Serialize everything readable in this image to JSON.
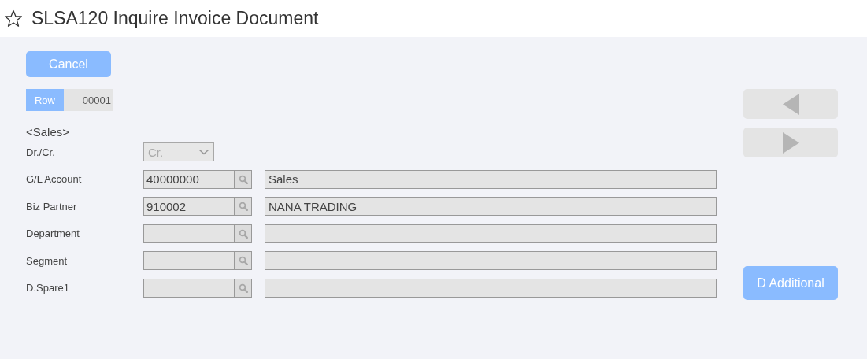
{
  "title": "SLSA120 Inquire Invoice Document",
  "cancel_button": "Cancel",
  "row_indicator": {
    "label": "Row",
    "value": "00001"
  },
  "section": "<Sales>",
  "dr_cr": {
    "label": "Dr./Cr.",
    "value": "Cr."
  },
  "lookups": [
    {
      "label": "G/L Account",
      "code": "40000000",
      "name": "Sales"
    },
    {
      "label": "Biz Partner",
      "code": "910002",
      "name": "NANA TRADING"
    },
    {
      "label": "Department"
    },
    {
      "label": "Segment"
    },
    {
      "label": "D.Spare1"
    }
  ],
  "additional_button": "D Additional"
}
